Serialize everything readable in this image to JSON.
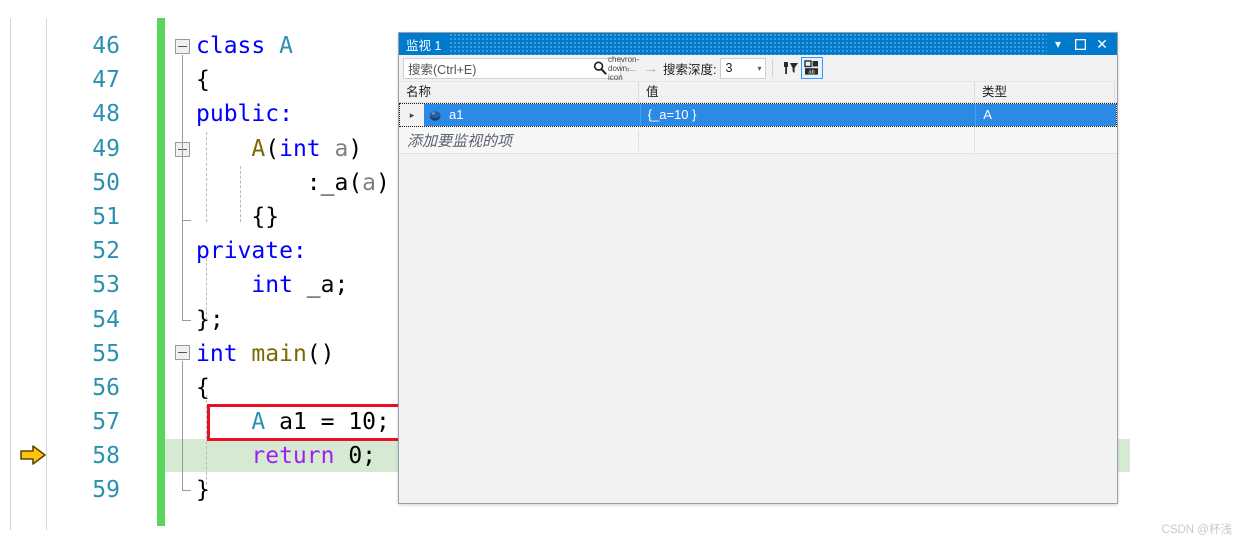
{
  "editor": {
    "lines": [
      {
        "number": "46",
        "segments": [
          {
            "t": "class ",
            "c": "kw"
          },
          {
            "t": "A",
            "c": "type"
          }
        ]
      },
      {
        "number": "47",
        "segments": [
          {
            "t": "{",
            "c": "plain"
          }
        ]
      },
      {
        "number": "48",
        "segments": [
          {
            "t": "public:",
            "c": "kw"
          }
        ]
      },
      {
        "number": "49",
        "segments": [
          {
            "t": "    ",
            "c": "plain"
          },
          {
            "t": "A",
            "c": "fn"
          },
          {
            "t": "(",
            "c": "plain"
          },
          {
            "t": "int",
            "c": "kw"
          },
          {
            "t": " ",
            "c": "plain"
          },
          {
            "t": "a",
            "c": "param"
          },
          {
            "t": ")",
            "c": "plain"
          }
        ]
      },
      {
        "number": "50",
        "segments": [
          {
            "t": "        :_a(",
            "c": "plain"
          },
          {
            "t": "a",
            "c": "param"
          },
          {
            "t": ")",
            "c": "plain"
          }
        ]
      },
      {
        "number": "51",
        "segments": [
          {
            "t": "    {}",
            "c": "plain"
          }
        ]
      },
      {
        "number": "52",
        "segments": [
          {
            "t": "private:",
            "c": "kw"
          }
        ]
      },
      {
        "number": "53",
        "segments": [
          {
            "t": "    ",
            "c": "plain"
          },
          {
            "t": "int",
            "c": "kw"
          },
          {
            "t": " _a;",
            "c": "plain"
          }
        ]
      },
      {
        "number": "54",
        "segments": [
          {
            "t": "};",
            "c": "plain"
          }
        ]
      },
      {
        "number": "55",
        "segments": [
          {
            "t": "int",
            "c": "kw"
          },
          {
            "t": " ",
            "c": "plain"
          },
          {
            "t": "main",
            "c": "fn"
          },
          {
            "t": "()",
            "c": "plain"
          }
        ]
      },
      {
        "number": "56",
        "segments": [
          {
            "t": "{",
            "c": "plain"
          }
        ]
      },
      {
        "number": "57",
        "segments": [
          {
            "t": "    ",
            "c": "plain"
          },
          {
            "t": "A",
            "c": "type"
          },
          {
            "t": " a1 = 10;",
            "c": "plain"
          }
        ]
      },
      {
        "number": "58",
        "segments": [
          {
            "t": "    ",
            "c": "plain"
          },
          {
            "t": "return",
            "c": "ctrl"
          },
          {
            "t": " 0;",
            "c": "plain"
          }
        ]
      },
      {
        "number": "59",
        "segments": [
          {
            "t": "}",
            "c": "plain"
          }
        ]
      }
    ],
    "execution_arrow_icon": "execution-pointer-arrow",
    "highlight_box_line": "57",
    "colors": {
      "keyword": "#0000ff",
      "type": "#2b91af",
      "function": "#7a6a00",
      "parameter": "#808080",
      "control": "#a020f0",
      "line_number": "#2b91af",
      "change_bar": "#57d65a",
      "current_line": "#d6ead3",
      "highlight_box": "#e81123"
    }
  },
  "watch_window": {
    "title": "监视 1",
    "titlebar_buttons": {
      "dropdown": "▾",
      "maximize": "❐",
      "close": "✕"
    },
    "toolbar": {
      "search_placeholder": "搜索(Ctrl+E)",
      "search_icon": "magnifier-icon",
      "search_dropdown_icon": "chevron-down-icon",
      "nav_back_icon": "arrow-left-icon",
      "nav_forward_icon": "arrow-right-icon",
      "depth_label": "搜索深度:",
      "depth_value": "3",
      "depth_caret_icon": "chevron-down-icon",
      "filter_button_icon": "pin-filter-icon",
      "hex_button_icon": "hexadecimal-display-icon"
    },
    "grid": {
      "columns": [
        "名称",
        "值",
        "类型"
      ],
      "rows": [
        {
          "expander": "▸",
          "icon": "object-variable-icon",
          "name": "a1",
          "value": "{_a=10 }",
          "type": "A",
          "selected": true
        }
      ],
      "add_row_placeholder": "添加要监视的项"
    },
    "accent_color": "#007acc",
    "selection_color": "#2a8ae4"
  },
  "watermark": "CSDN @杯浅"
}
